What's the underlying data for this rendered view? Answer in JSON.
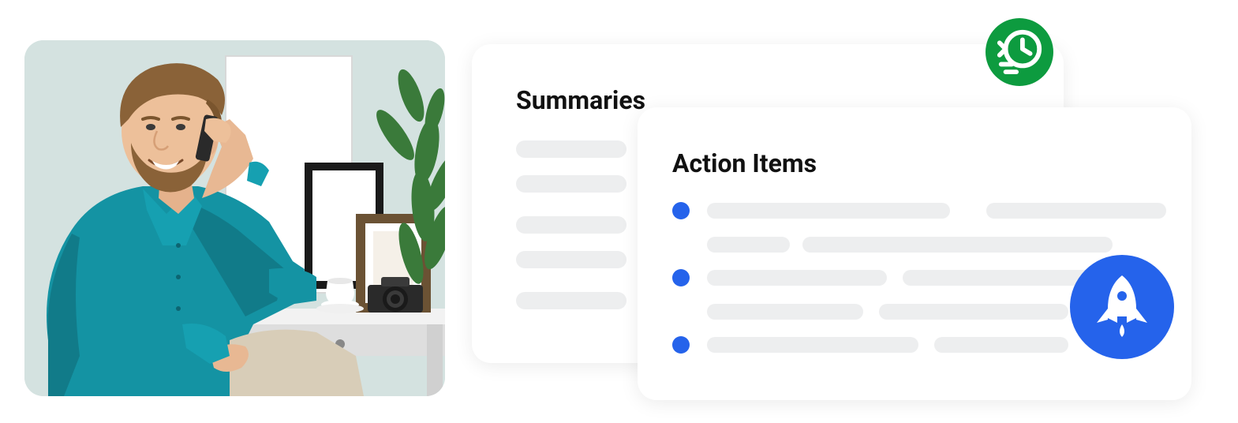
{
  "colors": {
    "accent_blue": "#2563eb",
    "accent_green": "#0d9b3f",
    "skeleton": "#edeeef"
  },
  "cards": {
    "summaries": {
      "title": "Summaries"
    },
    "action_items": {
      "title": "Action Items"
    }
  },
  "icons": {
    "clock": "history-clock-icon",
    "rocket": "rocket-icon"
  }
}
